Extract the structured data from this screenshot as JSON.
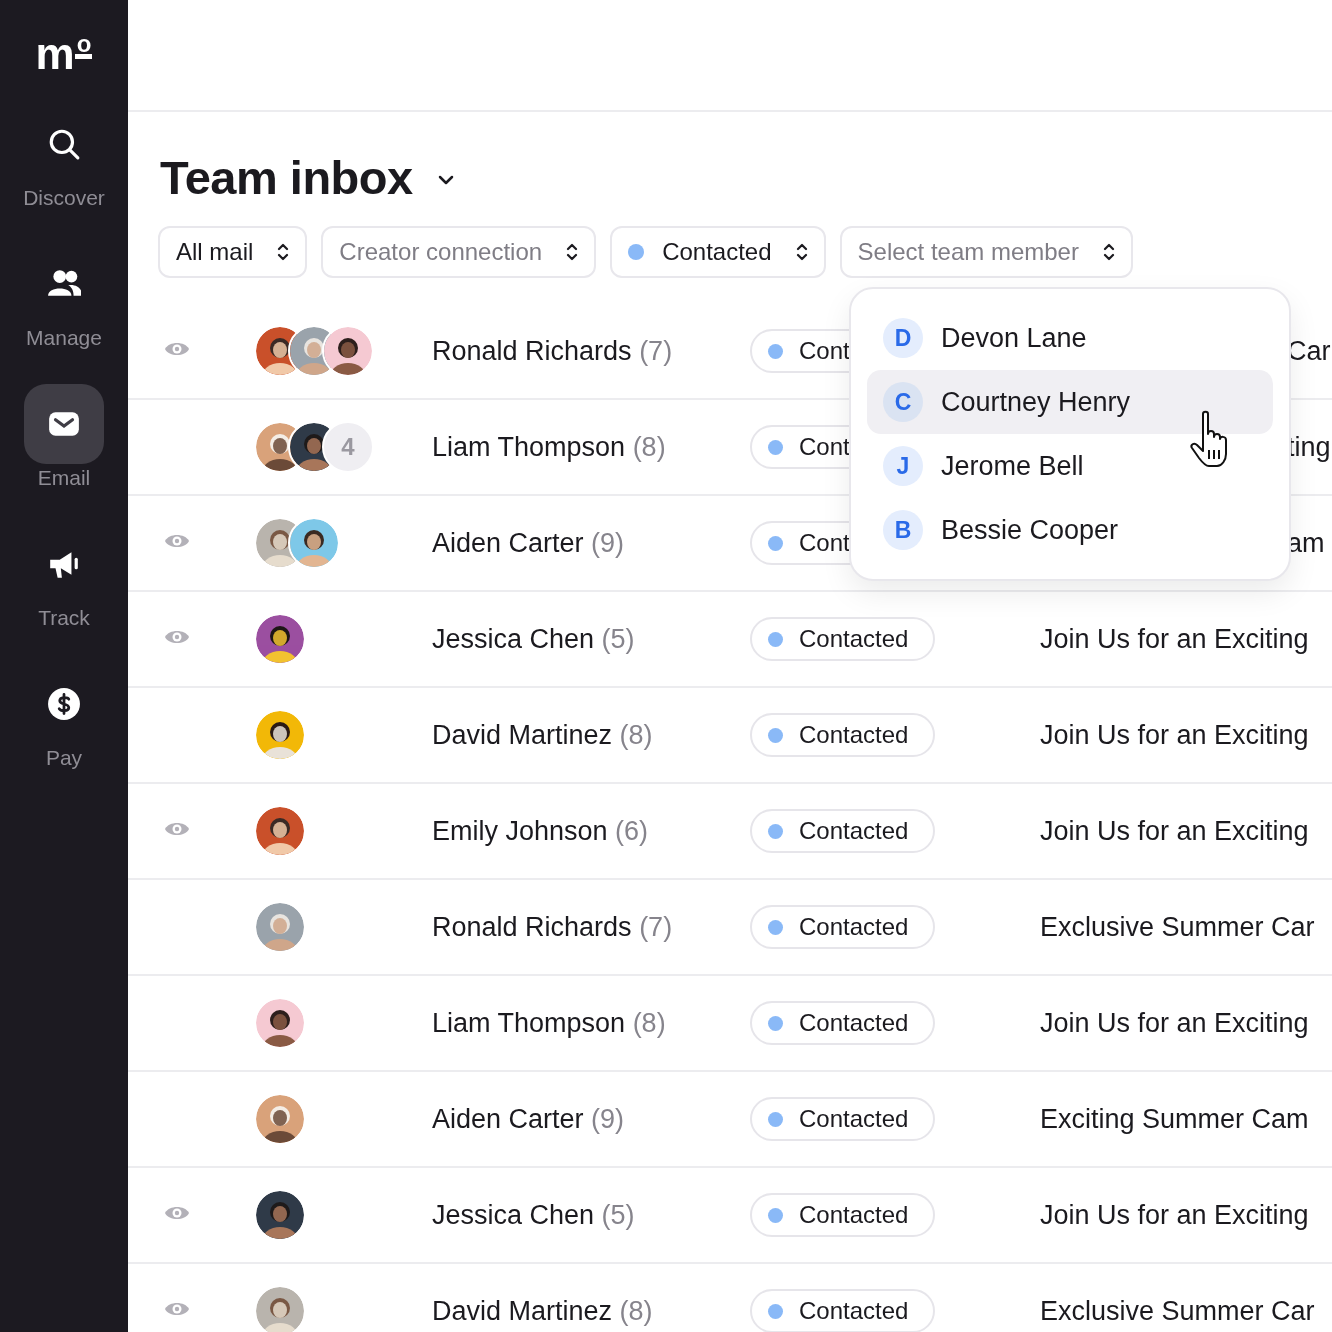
{
  "sidebar": {
    "logo": {
      "text": "m",
      "mark": "o"
    },
    "items": [
      {
        "kind": "search",
        "label": "Discover",
        "selected": false
      },
      {
        "kind": "people",
        "label": "Manage",
        "selected": false
      },
      {
        "kind": "mail",
        "label": "Email",
        "selected": true
      },
      {
        "kind": "megaphone",
        "label": "Track",
        "selected": false
      },
      {
        "kind": "dollar",
        "label": "Pay",
        "selected": false
      }
    ]
  },
  "title": "Team inbox",
  "filters": [
    {
      "value": "All mail"
    },
    {
      "placeholder": "Creator connection"
    },
    {
      "value": "Contacted",
      "dot": true
    },
    {
      "placeholder": "Select team member"
    }
  ],
  "rows": [
    {
      "seen": true,
      "name": "Ronald Richards",
      "count": "(7)",
      "status": "Cont",
      "subject": "Car",
      "covered": true
    },
    {
      "seen": false,
      "more": "4",
      "name": "Liam Thompson",
      "count": "(8)",
      "status": "Cont",
      "subject": "ting",
      "covered": true
    },
    {
      "seen": true,
      "name": "Aiden Carter",
      "count": "(9)",
      "status": "Cont",
      "subject": "am",
      "covered": true
    },
    {
      "seen": true,
      "name": "Jessica Chen",
      "count": "(5)",
      "status": "Contacted",
      "subject": "Join Us for an Exciting",
      "covered": false
    },
    {
      "seen": false,
      "name": "David Martinez",
      "count": "(8)",
      "status": "Contacted",
      "subject": "Join Us for an Exciting",
      "covered": false
    },
    {
      "seen": true,
      "name": "Emily Johnson",
      "count": "(6)",
      "status": "Contacted",
      "subject": "Join Us for an Exciting",
      "covered": false
    },
    {
      "seen": false,
      "name": "Ronald Richards",
      "count": "(7)",
      "status": "Contacted",
      "subject": "Exclusive Summer Car",
      "covered": false
    },
    {
      "seen": false,
      "name": "Liam Thompson",
      "count": "(8)",
      "status": "Contacted",
      "subject": "Join Us for an Exciting",
      "covered": false
    },
    {
      "seen": false,
      "name": "Aiden Carter",
      "count": "(9)",
      "status": "Contacted",
      "subject": "Exciting Summer Cam",
      "covered": false
    },
    {
      "seen": true,
      "name": "Jessica Chen",
      "count": "(5)",
      "status": "Contacted",
      "subject": "Join Us for an Exciting",
      "covered": false
    },
    {
      "seen": true,
      "name": "David Martinez",
      "count": "(8)",
      "status": "Contacted",
      "subject": "Exclusive Summer Car",
      "covered": false
    }
  ],
  "dropdown": {
    "items": [
      {
        "initial": "D",
        "name": "Devon Lane",
        "selected": false
      },
      {
        "initial": "C",
        "name": "Courtney Henry",
        "selected": true
      },
      {
        "initial": "J",
        "name": "Jerome Bell",
        "selected": false
      },
      {
        "initial": "B",
        "name": "Bessie Cooper",
        "selected": false
      }
    ]
  }
}
